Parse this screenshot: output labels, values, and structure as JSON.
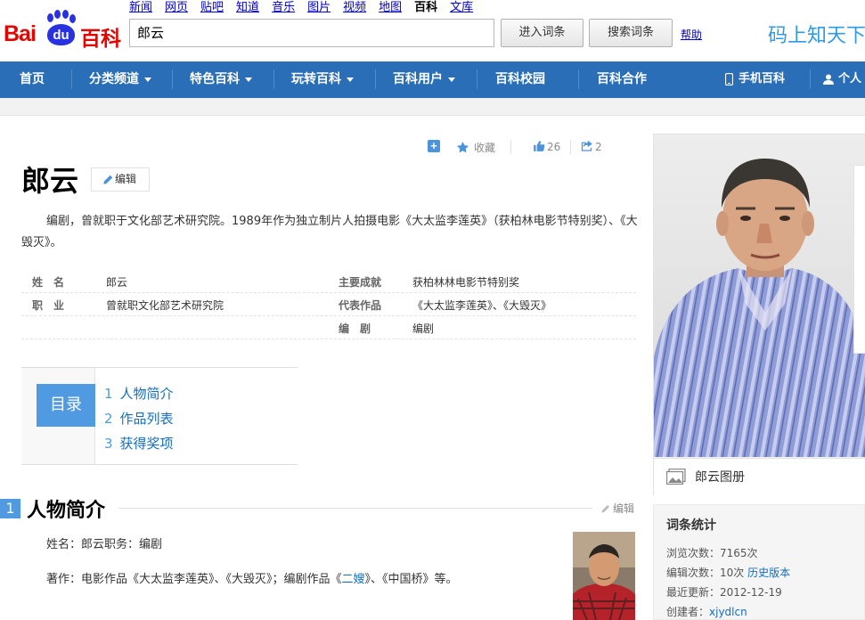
{
  "logo": {
    "bai": "Bai",
    "du": "du",
    "baike": "百科"
  },
  "topnav": [
    "新闻",
    "网页",
    "贴吧",
    "知道",
    "音乐",
    "图片",
    "视频",
    "地图",
    "百科",
    "文库"
  ],
  "search": {
    "value": "郎云",
    "enter_label": "进入词条",
    "search_label": "搜索词条",
    "help_label": "帮助"
  },
  "slogan": "码上知天下",
  "mainnav": {
    "home": "首页",
    "category": "分类频道",
    "special": "特色百科",
    "play": "玩转百科",
    "users": "百科用户",
    "campus": "百科校园",
    "cooperation": "百科合作",
    "mobile": "手机百科",
    "personal": "个人"
  },
  "toolbar": {
    "collect": "收藏",
    "likes": "26",
    "shares": "2"
  },
  "entry": {
    "title": "郎云",
    "edit_label": "编辑",
    "summary": "编剧，曾就职于文化部艺术研究院。1989年作为独立制片人拍摄电影《大太监李莲英》（获柏林电影节特别奖）、《大毁灭》。"
  },
  "infobox": {
    "name_key": "姓　名",
    "name_val": "郎云",
    "job_key": "职　业",
    "job_val": "曾就职文化部艺术研究院",
    "ach_key": "主要成就",
    "ach_val": "获柏林林电影节特别奖",
    "works_key": "代表作品",
    "works_val": "《大太监李莲英》、《大毁灭》",
    "writer_key": "编　剧",
    "writer_val": "编剧"
  },
  "catalog": {
    "label": "目录",
    "items": [
      {
        "num": "1",
        "text": "人物简介"
      },
      {
        "num": "2",
        "text": "作品列表"
      },
      {
        "num": "3",
        "text": "获得奖项"
      }
    ]
  },
  "section1": {
    "num": "1",
    "title": "人物简介",
    "edit": "编辑",
    "p1": "姓名：郎云职务：编剧",
    "p2_pre": "著作：电影作品《大太监李莲英》、《大毁灭》；编剧作品《",
    "p2_link": "二嫂",
    "p2_post": "》、《中国桥》等。"
  },
  "album": {
    "label": "郎云图册"
  },
  "stats": {
    "title": "词条统计",
    "views_label": "浏览次数：",
    "views": "7165次",
    "edits_label": "编辑次数：",
    "edits": "10次",
    "history": "历史版本",
    "updated_label": "最近更新：",
    "updated": "2012-12-19",
    "creator_label": "创建者：",
    "creator": "xjydlcn"
  },
  "colors": {
    "nav_blue": "#2a6eb7",
    "accent": "#4f9ae0",
    "logo_red": "#e10601",
    "logo_blue": "#2932e1"
  }
}
